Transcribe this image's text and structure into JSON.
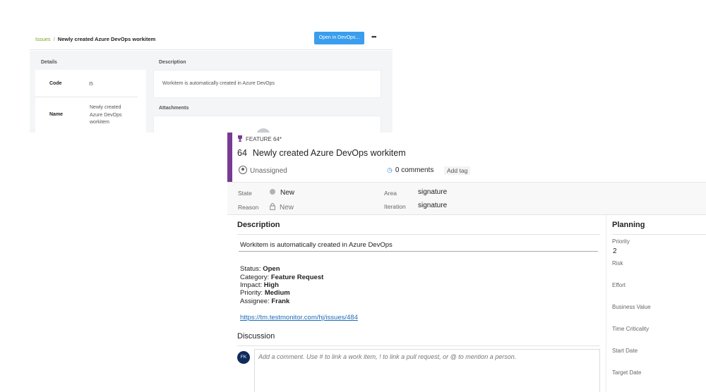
{
  "back_window": {
    "breadcrumb": {
      "root": "Issues",
      "separator": "/",
      "current": "Newly created Azure DevOps workitem"
    },
    "open_button": "Open in DevOps...",
    "more_label": "•••",
    "details_title": "Details",
    "details": [
      {
        "key": "Code",
        "value": "I5"
      },
      {
        "key": "Name",
        "value": "Newly created Azure DevOps workitem"
      }
    ],
    "description_title": "Description",
    "description_text": "Workitem is automatically created in Azure DevOps",
    "attachments_title": "Attachments"
  },
  "work_item": {
    "type_label": "FEATURE 64*",
    "id": "64",
    "title": "Newly created Azure DevOps workitem",
    "assignee": "Unassigned",
    "comments": "0 comments",
    "add_tag": "Add tag",
    "fields": {
      "state_label": "State",
      "state_value": "New",
      "reason_label": "Reason",
      "reason_value": "New",
      "area_label": "Area",
      "area_value": "signature",
      "iteration_label": "Iteration",
      "iteration_value": "signature"
    },
    "description_heading": "Description",
    "description_main": "Workitem is automatically created in Azure DevOps",
    "details": [
      {
        "label": "Status: ",
        "value": "Open"
      },
      {
        "label": "Category: ",
        "value": "Feature Request"
      },
      {
        "label": "Impact: ",
        "value": "High"
      },
      {
        "label": "Priority: ",
        "value": "Medium"
      },
      {
        "label": "Assignee: ",
        "value": "Frank"
      }
    ],
    "link": "https://tm.testmonitor.com/hj/issues/484",
    "discussion_heading": "Discussion",
    "user_initials": "FK",
    "comment_placeholder": "Add a comment. Use # to link a work item, ! to link a pull request, or @ to mention a person.",
    "planning": {
      "heading": "Planning",
      "priority_label": "Priority",
      "priority_value": "2",
      "risk_label": "Risk",
      "effort_label": "Effort",
      "business_value_label": "Business Value",
      "time_criticality_label": "Time Criticality",
      "start_date_label": "Start Date",
      "target_date_label": "Target Date"
    }
  },
  "colors": {
    "accent_purple": "#773b93",
    "button_blue": "#3a9ded",
    "link_blue": "#1e6bb8",
    "breadcrumb_green": "#7aa51c"
  }
}
